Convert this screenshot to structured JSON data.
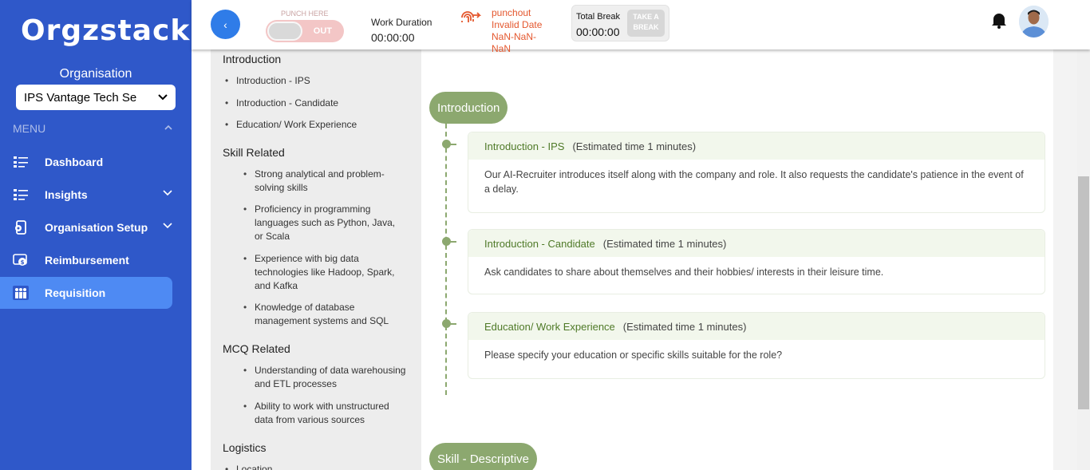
{
  "sidebar": {
    "logo": "Orgzstack",
    "org_title": "Organisation",
    "org_select_value": "IPS Vantage Tech Se",
    "menu_label": "MENU",
    "items": [
      {
        "label": "Dashboard",
        "icon": "list-icon"
      },
      {
        "label": "Insights",
        "icon": "list-icon"
      },
      {
        "label": "Organisation Setup",
        "icon": "org-setup-icon"
      },
      {
        "label": "Reimbursement",
        "icon": "reimbursement-icon"
      },
      {
        "label": "Requisition",
        "icon": "people-icon"
      }
    ]
  },
  "topbar": {
    "back_icon": "‹",
    "punch_label": "PUNCH HERE",
    "punch_toggle": "OUT",
    "work_duration_title": "Work Duration",
    "work_duration_value": "00:00:00",
    "punchout_label": "punchout",
    "punchout_date": "Invalid Date",
    "punchout_nan": "NaN-NaN-NaN",
    "break_title": "Total Break",
    "break_value": "00:00:00",
    "break_button": "TAKE A BREAK"
  },
  "left_panel": {
    "sections": [
      {
        "title": "Introduction",
        "items": [
          "Introduction - IPS",
          "Introduction - Candidate",
          "Education/ Work Experience"
        ]
      },
      {
        "title": "Skill Related",
        "items": [
          "Strong analytical and problem-solving skills",
          "Proficiency in programming languages such as Python, Java, or Scala",
          "Experience with big data technologies like Hadoop, Spark, and Kafka",
          "Knowledge of database management systems and SQL"
        ]
      },
      {
        "title": "MCQ Related",
        "items": [
          "Understanding of data warehousing and ETL processes",
          "Ability to work with unstructured data from various sources"
        ]
      },
      {
        "title": "Logistics",
        "items": [
          "Location"
        ]
      }
    ]
  },
  "main": {
    "section_pill_1": "Introduction",
    "section_pill_2": "Skill - Descriptive",
    "cards": [
      {
        "title": "Introduction - IPS",
        "estimate": "(Estimated time 1 minutes)",
        "body": "Our AI-Recruiter introduces itself along with the company and role. It also requests the candidate's patience in the event of a delay."
      },
      {
        "title": "Introduction - Candidate",
        "estimate": "(Estimated time 1 minutes)",
        "body": "Ask candidates to share about themselves and their hobbies/ interests in their leisure time."
      },
      {
        "title": "Education/ Work Experience",
        "estimate": "(Estimated time 1 minutes)",
        "body": "Please specify your education or specific skills suitable for the role?"
      }
    ]
  },
  "colors": {
    "sidebar": "#2f58c9",
    "active": "#4e8af3",
    "accent_green": "#8ca86f",
    "punchout": "#e4572e"
  }
}
